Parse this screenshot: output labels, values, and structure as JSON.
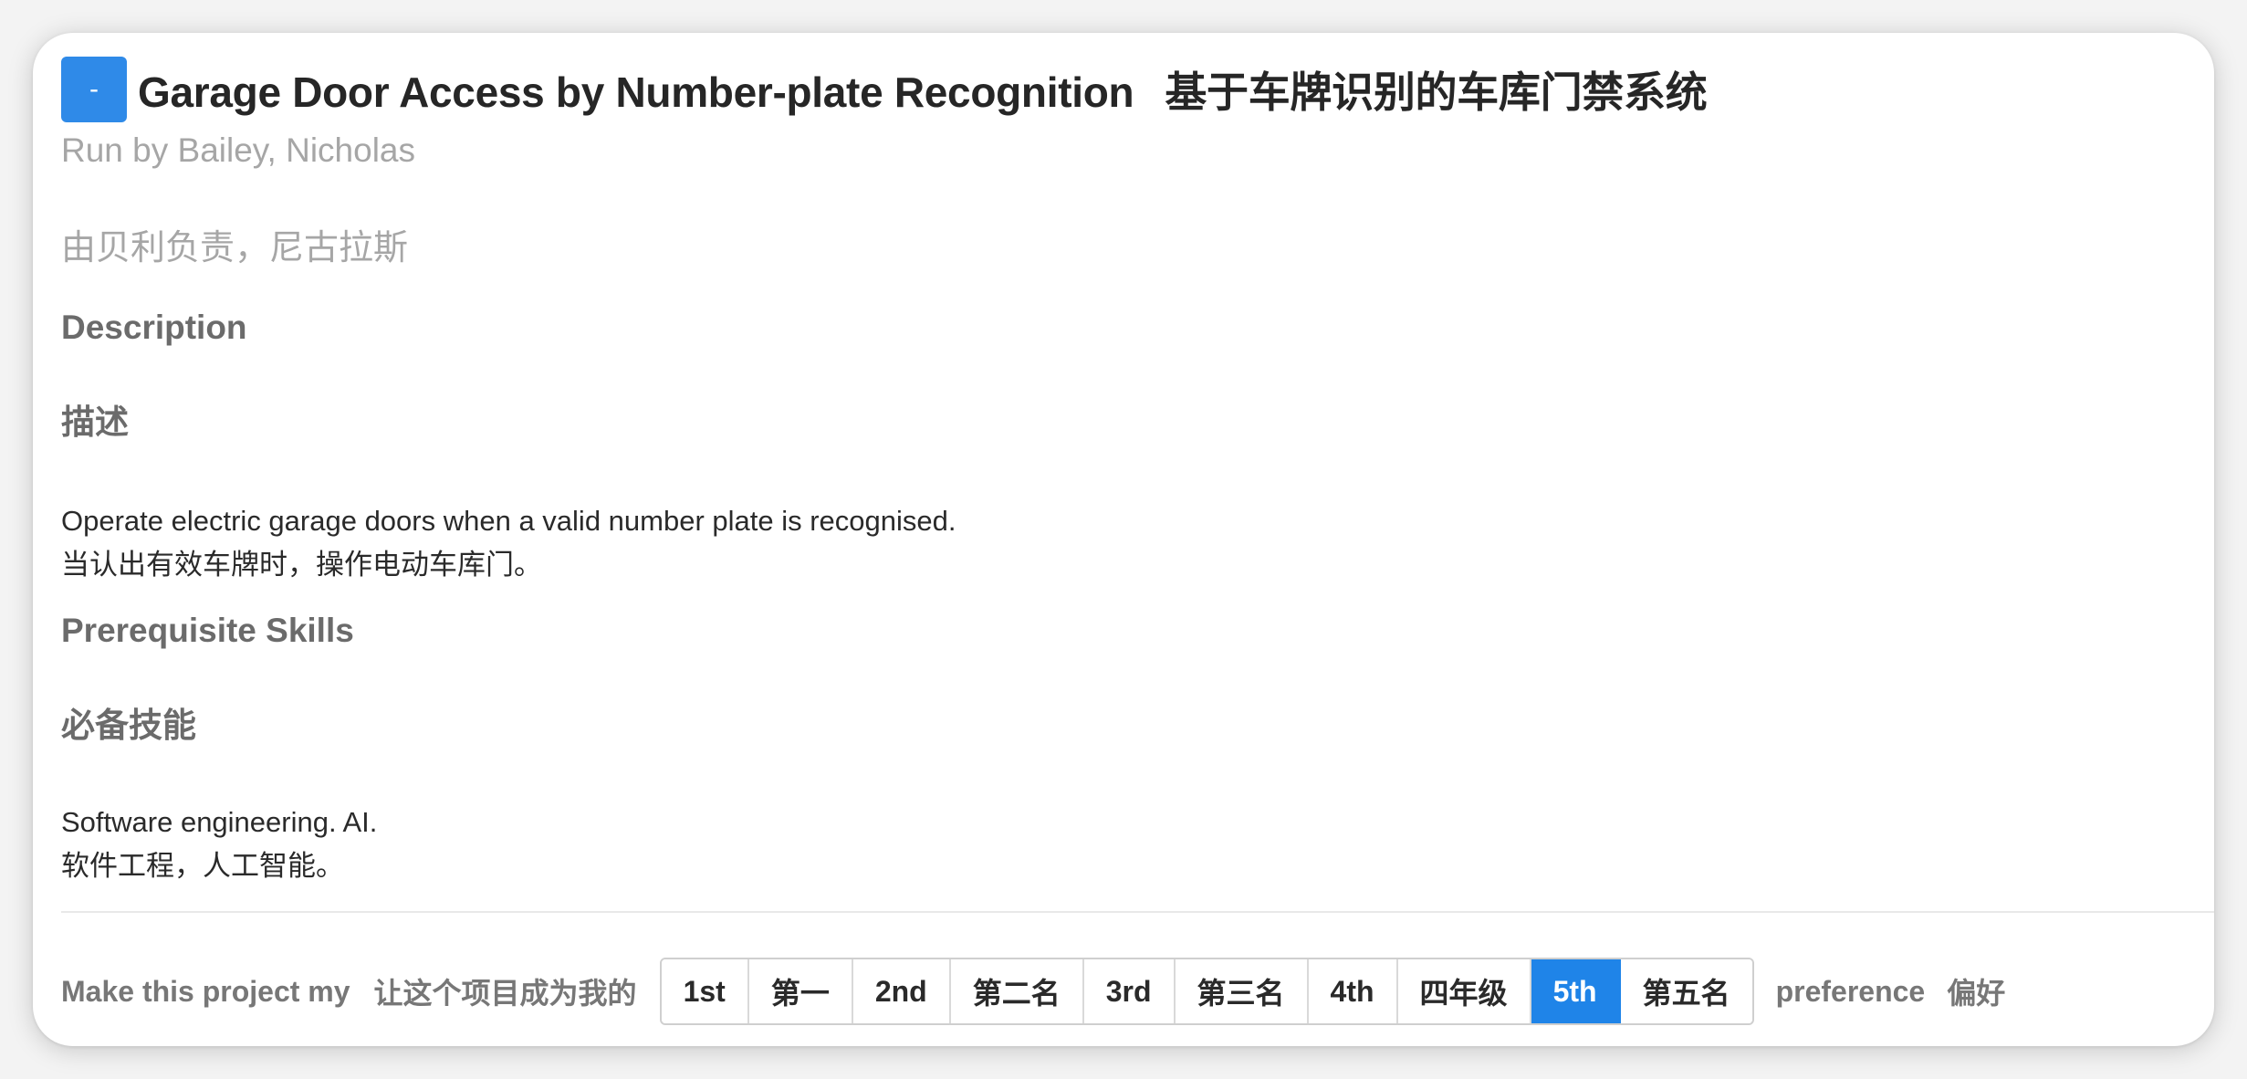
{
  "project": {
    "toggle_label": "-",
    "title_en": "Garage Door Access by Number-plate Recognition",
    "title_zh": "基于车牌识别的车库门禁系统",
    "run_by_en": "Run by Bailey, Nicholas",
    "run_by_zh": "由贝利负责，尼古拉斯",
    "accent_color": "#2f8ae8"
  },
  "description": {
    "heading_en": "Description",
    "heading_zh": "描述",
    "text_en": "Operate electric garage doors when a valid number plate is recognised.",
    "text_zh": "当认出有效车牌时，操作电动车库门。"
  },
  "prerequisites": {
    "heading_en": "Prerequisite Skills",
    "heading_zh": "必备技能",
    "text_en": "Software engineering. AI.",
    "text_zh": "软件工程，人工智能。"
  },
  "preference": {
    "label_en": "Make this project my",
    "label_zh": "让这个项目成为我的",
    "options": [
      "1st",
      "第一",
      "2nd",
      "第二名",
      "3rd",
      "第三名",
      "4th",
      "四年级",
      "5th",
      "第五名"
    ],
    "selected": "5th",
    "suffix_en": "preference",
    "suffix_zh": "偏好"
  }
}
